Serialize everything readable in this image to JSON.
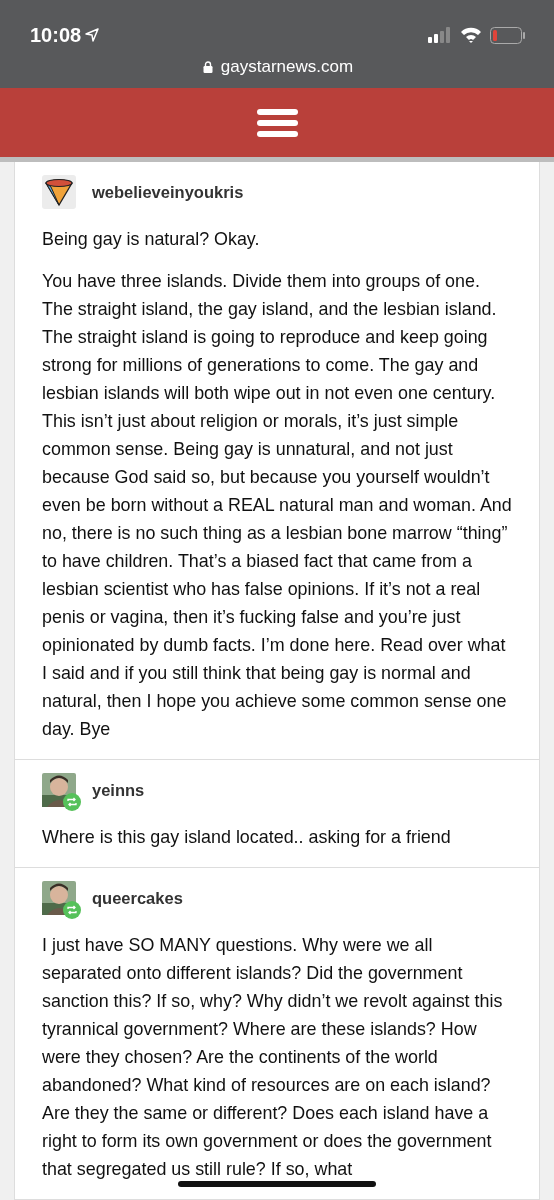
{
  "status_bar": {
    "time": "10:08"
  },
  "browser": {
    "url": "gaystarnews.com"
  },
  "posts": [
    {
      "username": "webelieveinyoukris",
      "avatar": {
        "kind": "icon"
      },
      "reblogged": false,
      "paragraphs": [
        "Being gay is natural? Okay.",
        "You have three islands. Divide them into groups of one. The straight island, the gay island, and the lesbian island. The straight island is going to reproduce and keep going strong for millions of generations to come. The gay and lesbian islands will both wipe out in not even one century. This isn’t just about religion or morals, it’s just simple common sense. Being gay is unnatural, and not just because God said so, but because you yourself wouldn’t even be born without a REAL natural man and woman. And no, there is no such thing as a lesbian bone marrow “thing” to have children. That’s a biased fact that came from a lesbian scientist who has false opinions. If it’s not a real penis or vagina, then it’s fucking false and you’re just opinionated by dumb facts. I’m done here. Read over what I said and if you still think that being gay is normal and natural, then I hope you achieve some common sense one day. Bye"
      ]
    },
    {
      "username": "yeinns",
      "avatar": {
        "kind": "picture"
      },
      "reblogged": true,
      "paragraphs": [
        "Where is this gay island located.. asking for a friend"
      ]
    },
    {
      "username": "queercakes",
      "avatar": {
        "kind": "picture"
      },
      "reblogged": true,
      "paragraphs": [
        "I just have SO MANY questions. Why were we all separated onto different islands? Did the government sanction this? If so, why? Why didn’t we revolt against this tyrannical government? Where are these islands? How were they chosen? Are the continents of the world abandoned? What kind of resources are on each island? Are they the same or different? Does each island have a right to form its own government or does the government that segregated us still rule? If so, what"
      ]
    }
  ]
}
